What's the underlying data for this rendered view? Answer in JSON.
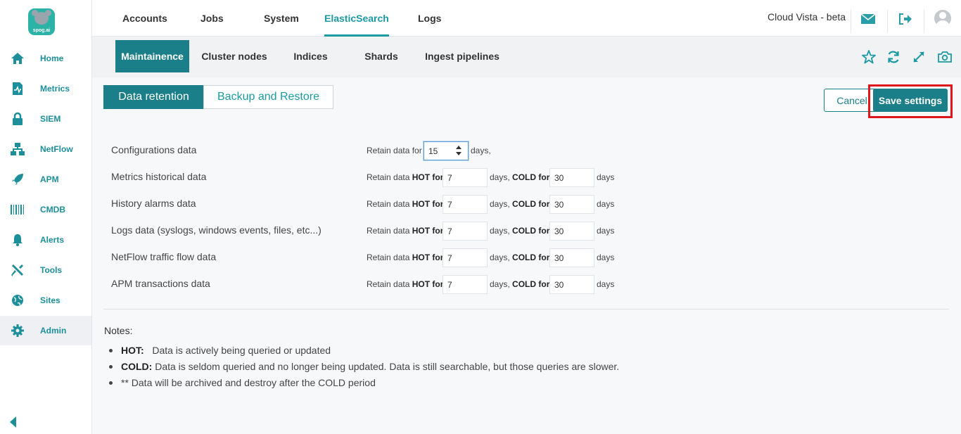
{
  "brand": {
    "logo_text": "spog.ai"
  },
  "sidebar": {
    "items": [
      {
        "label": "Home",
        "icon": "home-icon"
      },
      {
        "label": "Metrics",
        "icon": "metrics-icon"
      },
      {
        "label": "SIEM",
        "icon": "lock-icon"
      },
      {
        "label": "NetFlow",
        "icon": "network-icon"
      },
      {
        "label": "APM",
        "icon": "rocket-icon"
      },
      {
        "label": "CMDB",
        "icon": "barcode-icon"
      },
      {
        "label": "Alerts",
        "icon": "bell-icon"
      },
      {
        "label": "Tools",
        "icon": "tools-icon"
      },
      {
        "label": "Sites",
        "icon": "globe-icon"
      },
      {
        "label": "Admin",
        "icon": "gear-icon"
      }
    ],
    "active": "Admin"
  },
  "topnav": {
    "tabs": [
      "Accounts",
      "Jobs",
      "System",
      "ElasticSearch",
      "Logs"
    ],
    "active": "ElasticSearch",
    "app_title": "Cloud Vista - beta"
  },
  "subnav": {
    "tabs": [
      "Maintainence",
      "Cluster nodes",
      "Indices",
      "Shards",
      "Ingest pipelines"
    ],
    "active": "Maintainence"
  },
  "segments": {
    "data_retention": "Data retention",
    "backup_restore": "Backup and Restore"
  },
  "actions": {
    "cancel": "Cancel",
    "save": "Save settings"
  },
  "retention": {
    "config": {
      "label": "Configurations data",
      "prefix": "Retain data for",
      "value": "15",
      "suffix": "days,"
    },
    "common": {
      "retain": "Retain data",
      "hot_for": "HOT for",
      "days_sep": "days,",
      "cold_for": "COLD for",
      "days": "days"
    },
    "rows": [
      {
        "label": "Metrics historical data",
        "hot": "7",
        "cold": "30"
      },
      {
        "label": "History alarms data",
        "hot": "7",
        "cold": "30"
      },
      {
        "label": "Logs data (syslogs, windows events, files, etc...)",
        "hot": "7",
        "cold": "30"
      },
      {
        "label": "NetFlow traffic flow data",
        "hot": "7",
        "cold": "30"
      },
      {
        "label": "APM transactions data",
        "hot": "7",
        "cold": "30"
      }
    ]
  },
  "notes": {
    "title": "Notes:",
    "items": [
      {
        "bold": "HOT:",
        "text": "Data is actively being queried or updated"
      },
      {
        "bold": "COLD:",
        "text": "Data is seldom queried and no longer being updated. Data is still searchable, but those queries are slower."
      },
      {
        "bold": "",
        "text": "** Data will be archived and destroy after the COLD period"
      }
    ]
  },
  "colors": {
    "accent": "#1a7f88",
    "accent_text": "#1c9aa4",
    "highlight": "#e0161d"
  }
}
